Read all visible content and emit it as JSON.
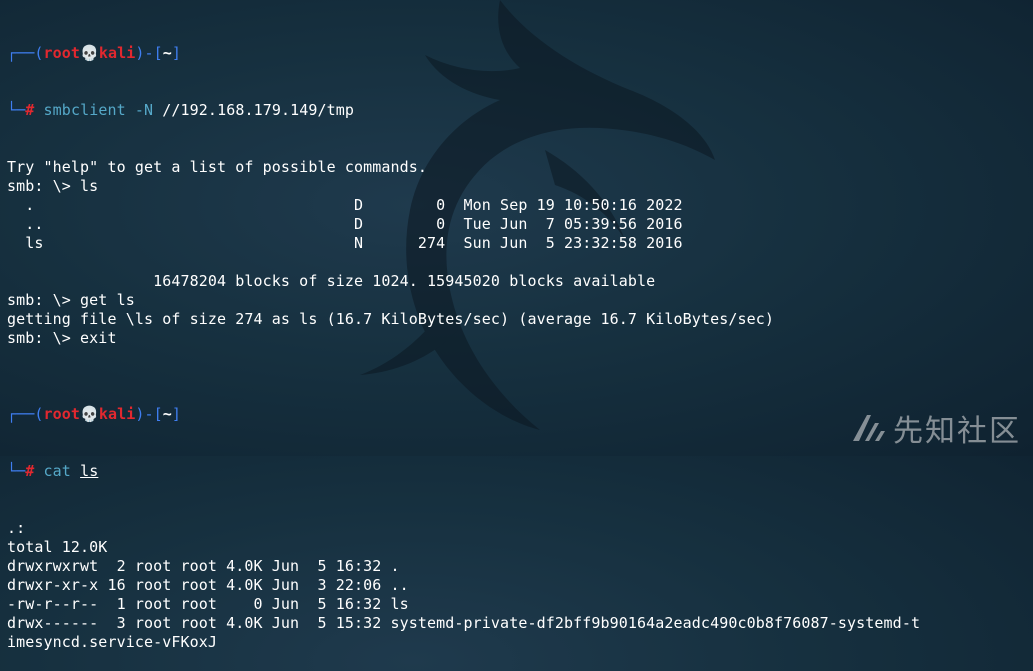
{
  "prompt1": {
    "user": "root",
    "skull": "💀",
    "host": "kali",
    "cwd": "~"
  },
  "cmd1": {
    "name": "smbclient",
    "flag": "-N",
    "arg": "//192.168.179.149/tmp"
  },
  "lines_smb": [
    "Try \"help\" to get a list of possible commands.",
    "smb: \\> ls",
    "  .                                   D        0  Mon Sep 19 10:50:16 2022",
    "  ..                                  D        0  Tue Jun  7 05:39:56 2016",
    "  ls                                  N      274  Sun Jun  5 23:32:58 2016",
    "",
    "                16478204 blocks of size 1024. 15945020 blocks available",
    "smb: \\> get ls",
    "getting file \\ls of size 274 as ls (16.7 KiloBytes/sec) (average 16.7 KiloBytes/sec)",
    "smb: \\> exit",
    ""
  ],
  "prompt2": {
    "user": "root",
    "skull": "💀",
    "host": "kali",
    "cwd": "~"
  },
  "cmd2": {
    "name": "cat",
    "arg": "ls"
  },
  "lines_cat": [
    ".:",
    "total 12.0K",
    "drwxrwxrwt  2 root root 4.0K Jun  5 16:32 .",
    "drwxr-xr-x 16 root root 4.0K Jun  3 22:06 ..",
    "-rw-r--r--  1 root root    0 Jun  5 16:32 ls",
    "drwx------  3 root root 4.0K Jun  5 15:32 systemd-private-df2bff9b90164a2eadc490c0b8f76087-systemd-t",
    "imesyncd.service-vFKoxJ"
  ],
  "watermark": {
    "text": "先知社区"
  }
}
